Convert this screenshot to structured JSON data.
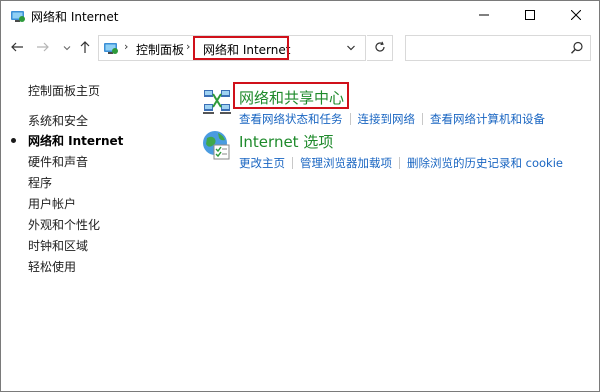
{
  "window": {
    "title": "网络和 Internet"
  },
  "titlebar": {
    "minimize_icon": "minimize-icon",
    "maximize_icon": "maximize-icon",
    "close_icon": "close-icon"
  },
  "address": {
    "breadcrumbs": [
      "控制面板",
      "网络和 Internet"
    ],
    "search_placeholder": ""
  },
  "sidebar": {
    "items": [
      {
        "label": "控制面板主页",
        "active": false
      },
      {
        "label": "系统和安全",
        "active": false
      },
      {
        "label": "网络和 Internet",
        "active": true
      },
      {
        "label": "硬件和声音",
        "active": false
      },
      {
        "label": "程序",
        "active": false
      },
      {
        "label": "用户帐户",
        "active": false
      },
      {
        "label": "外观和个性化",
        "active": false
      },
      {
        "label": "时钟和区域",
        "active": false
      },
      {
        "label": "轻松使用",
        "active": false
      }
    ]
  },
  "main": {
    "categories": [
      {
        "title": "网络和共享中心",
        "icon": "network-sharing-center-icon",
        "links": [
          "查看网络状态和任务",
          "连接到网络",
          "查看网络计算机和设备"
        ]
      },
      {
        "title": "Internet 选项",
        "icon": "internet-options-icon",
        "links": [
          "更改主页",
          "管理浏览器加载项",
          "删除浏览的历史记录和 cookie"
        ]
      }
    ]
  },
  "colors": {
    "category_title": "#1e8a2b",
    "link": "#1a66c2",
    "highlight_box": "#d0101a"
  }
}
